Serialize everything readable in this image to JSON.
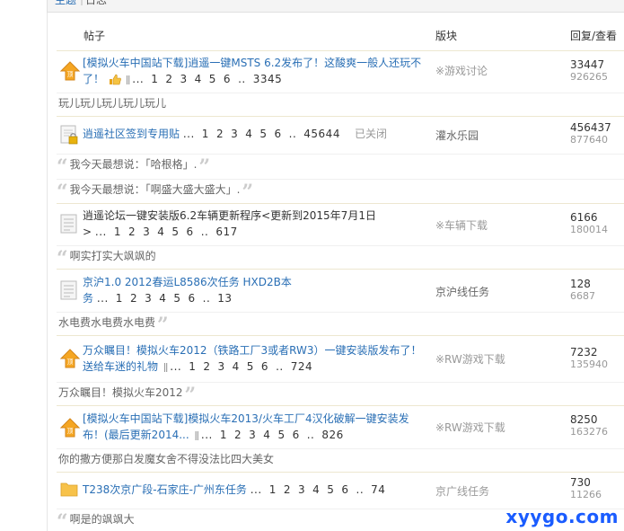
{
  "breadcrumb": {
    "first": "主题",
    "second": "日志"
  },
  "header": {
    "thread": "帖子",
    "forum": "版块",
    "stats": "回复/查看"
  },
  "threads": [
    {
      "icon": "top-icon",
      "title_line1": "[模拟火车中国站下载]逍遥一键MSTS 6.2发布了！这酸爽一般人还玩不",
      "title_line2": "了！",
      "pages": [
        "...",
        "1",
        "2",
        "3",
        "4",
        "5",
        "6",
        "..",
        "3345"
      ],
      "forum": "※游戏讨论",
      "replies": "33447",
      "views": "926265",
      "quotes": [
        "玩儿玩儿玩儿玩儿玩儿"
      ]
    },
    {
      "icon": "locked-icon",
      "title_line1": "逍遥社区签到专用贴",
      "pages": [
        "...",
        "1",
        "2",
        "3",
        "4",
        "5",
        "6",
        "..",
        "45644"
      ],
      "closed": "已关闭",
      "forum": "灌水乐园",
      "replies": "456437",
      "views": "877640",
      "quotes": [
        "我今天最想说：「哈根格」.",
        "我今天最想说：「啊盛大盛大盛大」."
      ]
    },
    {
      "icon": "doc-icon",
      "title_line1": "逍遥论坛一键安装版6.2车辆更新程序<更新到2015年7月1日",
      "title_line2": ">",
      "pages": [
        "...",
        "1",
        "2",
        "3",
        "4",
        "5",
        "6",
        "..",
        "617"
      ],
      "forum": "※车辆下载",
      "replies": "6166",
      "views": "180014",
      "quotes": [
        "啊实打实大飒飒的"
      ]
    },
    {
      "icon": "doc-icon",
      "title_line1": "京沪1.0 2012春运L8586次任务 HXD2B本",
      "title_line2": "务",
      "pages": [
        "...",
        "1",
        "2",
        "3",
        "4",
        "5",
        "6",
        "..",
        "13"
      ],
      "forum": "京沪线任务",
      "replies": "128",
      "views": "6687",
      "quotes": [
        "水电费水电费水电费"
      ]
    },
    {
      "icon": "top-icon",
      "title_line1": "万众瞩目！模拟火车2012（铁路工厂3或者RW3）一键安装版发布了！",
      "title_line2": "送给车迷的礼物",
      "pages": [
        "...",
        "1",
        "2",
        "3",
        "4",
        "5",
        "6",
        "..",
        "724"
      ],
      "forum": "※RW游戏下载",
      "replies": "7232",
      "views": "135940",
      "quotes": [
        "万众瞩目！模拟火车2012"
      ]
    },
    {
      "icon": "top-icon",
      "title_line1": "[模拟火车中国站下载]模拟火车2013/火车工厂4汉化破解一键安装发",
      "title_line2": "布！(最后更新2014...",
      "pages": [
        "...",
        "1",
        "2",
        "3",
        "4",
        "5",
        "6",
        "..",
        "826"
      ],
      "forum": "※RW游戏下载",
      "replies": "8250",
      "views": "163276",
      "quotes": [
        "你的撒方便那白发魔女舍不得没法比四大美女"
      ]
    },
    {
      "icon": "folder-icon",
      "title_line1": "T238次京广段-石家庄-广州东任务",
      "pages": [
        "...",
        "1",
        "2",
        "3",
        "4",
        "5",
        "6",
        "..",
        "74"
      ],
      "forum": "京广线任务",
      "replies": "730",
      "views": "11266",
      "quotes": [
        "啊是的飒飒大"
      ]
    }
  ],
  "watermark": "xyygo.com"
}
